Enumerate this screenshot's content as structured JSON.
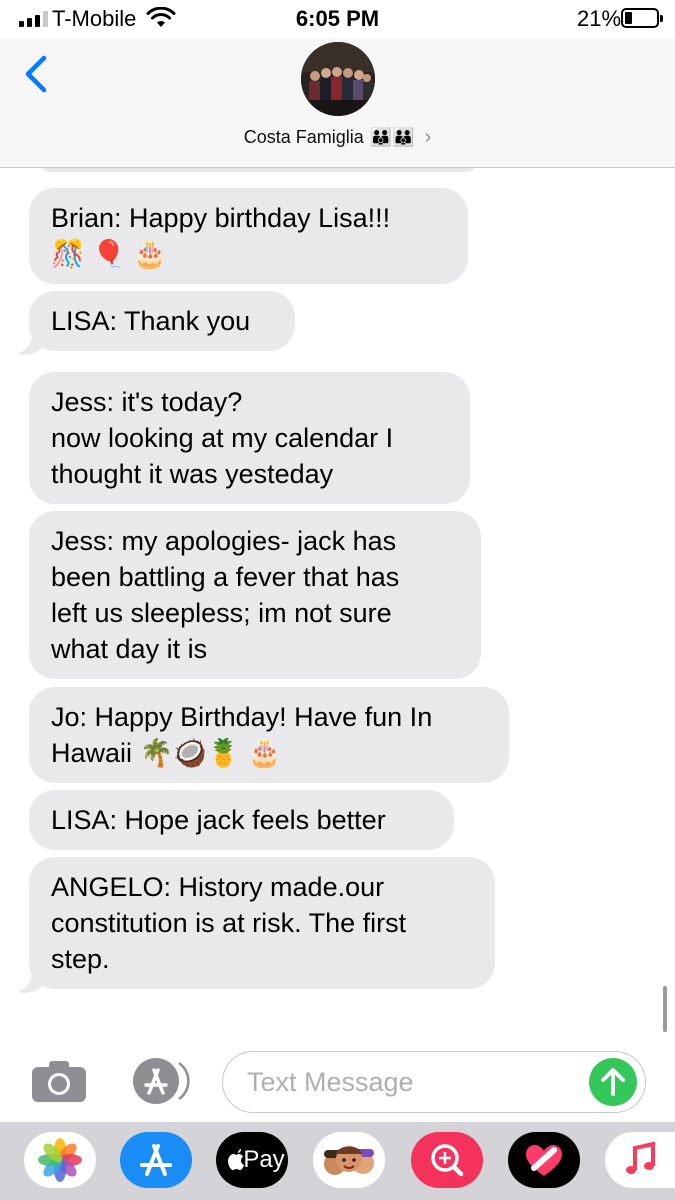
{
  "status_bar": {
    "carrier": "T-Mobile",
    "time": "6:05 PM",
    "battery_percent": "21%",
    "signal_bars_active": 3,
    "signal_bars_total": 4,
    "battery_level": 0.21
  },
  "header": {
    "contact_name": "Costa Famiglia",
    "contact_emoji": "👪👪",
    "back_icon": "chevron-left-icon",
    "disclosure_icon": "chevron-right-icon"
  },
  "messages": [
    {
      "sender": "Brian",
      "text": "Brian: Happy birthday Lisa!!!\n🎊 🎈 🎂"
    },
    {
      "sender": "LISA",
      "text": "LISA: Thank you"
    },
    {
      "sender": "Jess",
      "text": "Jess: it's today?\nnow looking at my calendar I\nthought it was yesteday"
    },
    {
      "sender": "Jess",
      "text": "Jess: my apologies- jack has\nbeen battling a fever that has\nleft us sleepless; im not sure\nwhat day it is"
    },
    {
      "sender": "Jo",
      "text": "Jo: Happy Birthday! Have fun In\nHawaii 🌴🥥🍍 🎂"
    },
    {
      "sender": "LISA",
      "text": "LISA: Hope jack feels better"
    },
    {
      "sender": "ANGELO",
      "text": "ANGELO: History made.our\nconstitution is at risk. The first\nstep."
    }
  ],
  "input": {
    "placeholder": "Text Message",
    "value": ""
  },
  "app_drawer": {
    "apps": [
      {
        "name": "Photos",
        "icon": "photos-icon"
      },
      {
        "name": "App Store",
        "icon": "app-store-icon"
      },
      {
        "name": "Apple Pay",
        "icon": "apple-pay-icon",
        "label": "Pay"
      },
      {
        "name": "Memoji",
        "icon": "memoji-icon"
      },
      {
        "name": "Images Search",
        "icon": "images-search-icon"
      },
      {
        "name": "Digital Touch",
        "icon": "digital-touch-icon"
      },
      {
        "name": "Music",
        "icon": "music-icon"
      }
    ]
  },
  "colors": {
    "accent": "#007aff",
    "bubble_gray": "#e9e9eb",
    "send_green": "#34c759",
    "header_bg": "#f6f6f6",
    "drawer_bg": "#d3d3d8"
  }
}
